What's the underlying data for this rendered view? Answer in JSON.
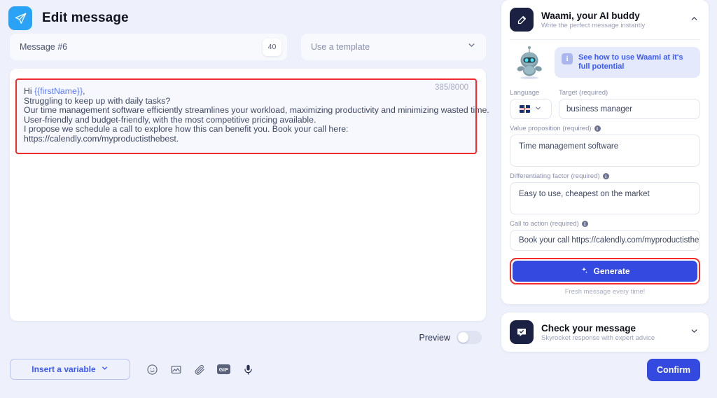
{
  "header": {
    "title": "Edit message",
    "send_icon": "paper-plane-icon"
  },
  "subject": {
    "value": "Message #6",
    "count_badge": "40"
  },
  "template": {
    "placeholder": "Use a template",
    "chevron": "chevron-down-icon"
  },
  "message": {
    "char_count": "385/8000",
    "lines": [
      {
        "prefix": "Hi ",
        "variable": "{{firstName}}",
        "suffix": ","
      },
      {
        "prefix": "Struggling to keep up with daily tasks?",
        "variable": "",
        "suffix": ""
      },
      {
        "prefix": "Our time management software efficiently streamlines your workload, maximizing productivity and minimizing wasted time.",
        "variable": "",
        "suffix": ""
      },
      {
        "prefix": "User-friendly and budget-friendly, with the most competitive pricing available.",
        "variable": "",
        "suffix": ""
      },
      {
        "prefix": "I propose we schedule a call to explore how this can benefit you. Book your call here:",
        "variable": "",
        "suffix": ""
      },
      {
        "prefix": "https://calendly.com/myproductisthebest.",
        "variable": "",
        "suffix": ""
      }
    ]
  },
  "preview": {
    "label": "Preview",
    "state": "off"
  },
  "toolbar": {
    "insert_variable_label": "Insert a variable",
    "icons": [
      "emoji-icon",
      "image-icon",
      "attachment-icon",
      "gif-icon",
      "microphone-icon"
    ]
  },
  "confirm": {
    "label": "Confirm"
  },
  "waami": {
    "title": "Waami, your AI buddy",
    "subtitle": "Write the perfect message instantly",
    "collapse_icon": "chevron-up-icon",
    "tile_icon": "compose-icon",
    "mascot": "robot-mascot",
    "banner": {
      "icon": "info-icon",
      "text": "See how to use Waami at it's full potential"
    },
    "fields": {
      "language_label": "Language",
      "language_flag": "uk-flag-icon",
      "target_label": "Target (required)",
      "target_value": "business manager",
      "value_prop_label": "Value proposition (required)",
      "value_prop_value": "Time management software",
      "diff_label": "Differentiating factor (required)",
      "diff_value": "Easy to use, cheapest on the market",
      "cta_label": "Call to action (required)",
      "cta_value": "Book your call https://calendly.com/myproductisthebest"
    },
    "generate_label": "Generate",
    "generate_icon": "sparkle-icon",
    "generate_note": "Fresh message every time!"
  },
  "check_message": {
    "title": "Check your message",
    "subtitle": "Skyrocket response with expert advice",
    "tile_icon": "chat-check-icon",
    "expand_icon": "chevron-down-icon"
  },
  "colors": {
    "accent_blue": "#3349e0",
    "light_blue": "#2aa3f7",
    "highlight_red": "#f42b2b",
    "page_bg": "#eef1fb"
  }
}
